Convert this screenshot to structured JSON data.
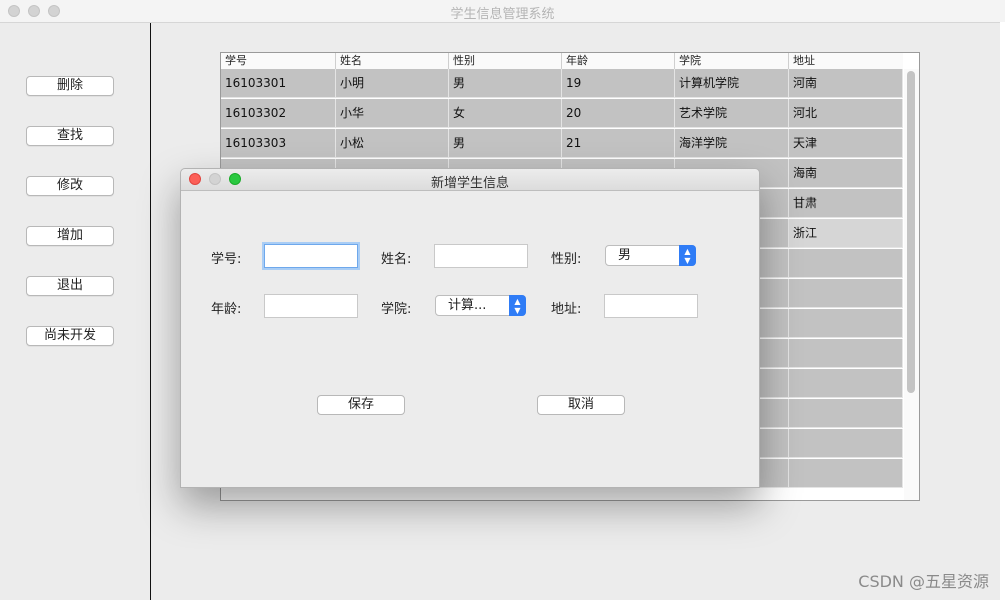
{
  "window": {
    "title": "学生信息管理系统"
  },
  "sidebar": {
    "buttons": [
      {
        "label": "删除"
      },
      {
        "label": "查找"
      },
      {
        "label": "修改"
      },
      {
        "label": "增加"
      },
      {
        "label": "退出"
      },
      {
        "label": "尚未开发"
      }
    ]
  },
  "table": {
    "headers": [
      "学号",
      "姓名",
      "性别",
      "年龄",
      "学院",
      "地址"
    ],
    "rows": [
      [
        "16103301",
        "小明",
        "男",
        "19",
        "计算机学院",
        "河南"
      ],
      [
        "16103302",
        "小华",
        "女",
        "20",
        "艺术学院",
        "河北"
      ],
      [
        "16103303",
        "小松",
        "男",
        "21",
        "海洋学院",
        "天津"
      ],
      [
        "",
        "",
        "",
        "",
        "",
        "海南"
      ],
      [
        "",
        "",
        "",
        "",
        "",
        "甘肃"
      ],
      [
        "",
        "",
        "",
        "",
        "",
        "浙江"
      ]
    ]
  },
  "dialog": {
    "title": "新增学生信息",
    "labels": {
      "id": "学号:",
      "name": "姓名:",
      "gender": "性别:",
      "age": "年龄:",
      "college": "学院:",
      "address": "地址:"
    },
    "fields": {
      "id": "",
      "name": "",
      "age": "",
      "address": ""
    },
    "gender_selected": "男",
    "college_selected": "计算...",
    "save_label": "保存",
    "cancel_label": "取消"
  },
  "watermark": "CSDN @五星资源"
}
